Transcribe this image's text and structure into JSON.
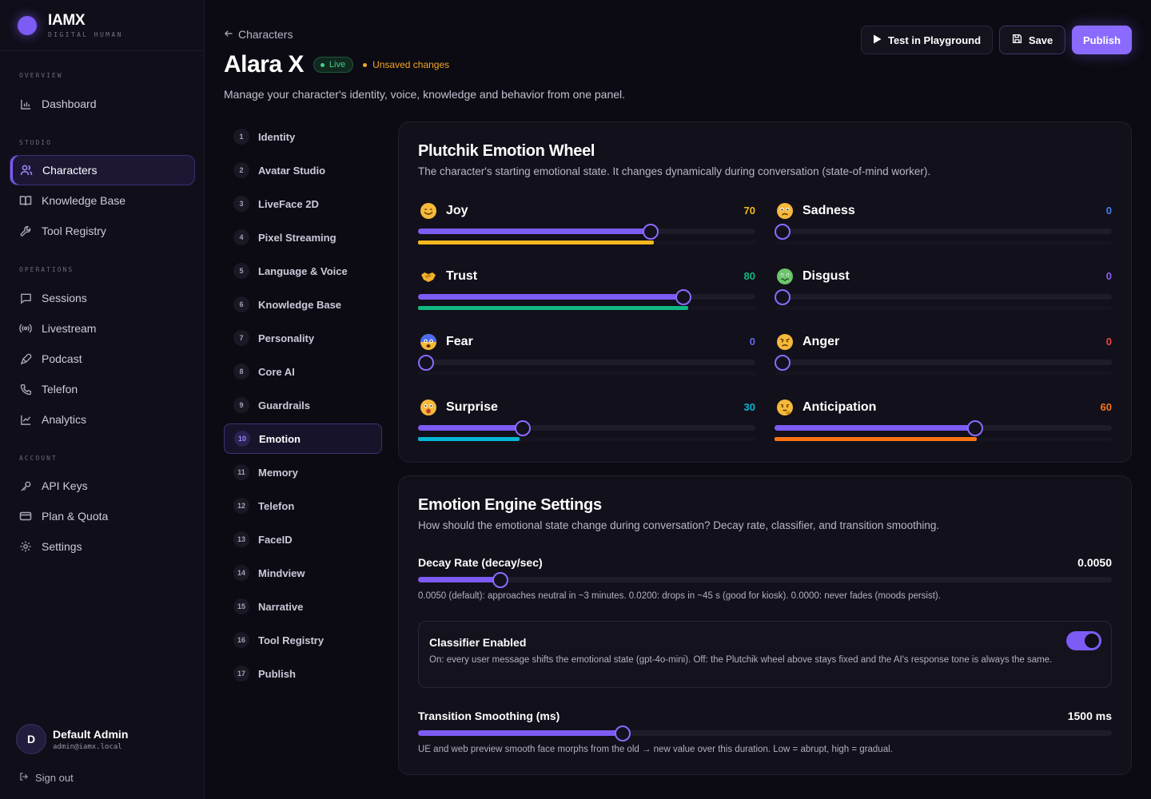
{
  "brand": {
    "name": "IAMX",
    "tagline": "DIGITAL HUMAN"
  },
  "sidebar": {
    "sections": [
      {
        "title": "OVERVIEW",
        "items": [
          {
            "label": "Dashboard",
            "icon": "bar-chart-icon"
          }
        ]
      },
      {
        "title": "STUDIO",
        "items": [
          {
            "label": "Characters",
            "icon": "users-icon",
            "active": true
          },
          {
            "label": "Knowledge Base",
            "icon": "book-icon"
          },
          {
            "label": "Tool Registry",
            "icon": "wrench-icon"
          }
        ]
      },
      {
        "title": "OPERATIONS",
        "items": [
          {
            "label": "Sessions",
            "icon": "chat-icon"
          },
          {
            "label": "Livestream",
            "icon": "broadcast-icon"
          },
          {
            "label": "Podcast",
            "icon": "mic-icon"
          },
          {
            "label": "Telefon",
            "icon": "phone-icon"
          },
          {
            "label": "Analytics",
            "icon": "line-chart-icon"
          }
        ]
      },
      {
        "title": "ACCOUNT",
        "items": [
          {
            "label": "API Keys",
            "icon": "key-icon"
          },
          {
            "label": "Plan & Quota",
            "icon": "card-icon"
          },
          {
            "label": "Settings",
            "icon": "gear-icon"
          }
        ]
      }
    ],
    "user": {
      "initial": "D",
      "name": "Default Admin",
      "email": "admin@iamx.local"
    },
    "sign_out": "Sign out"
  },
  "header": {
    "breadcrumb": "Characters",
    "title": "Alara X",
    "status_badge": "Live",
    "unsaved": "Unsaved changes",
    "subtitle": "Manage your character's identity, voice, knowledge and behavior from one panel.",
    "buttons": {
      "test": "Test in Playground",
      "save": "Save",
      "publish": "Publish"
    }
  },
  "steps": [
    {
      "num": "1",
      "label": "Identity"
    },
    {
      "num": "2",
      "label": "Avatar Studio"
    },
    {
      "num": "3",
      "label": "LiveFace 2D"
    },
    {
      "num": "4",
      "label": "Pixel Streaming"
    },
    {
      "num": "5",
      "label": "Language & Voice"
    },
    {
      "num": "6",
      "label": "Knowledge Base"
    },
    {
      "num": "7",
      "label": "Personality"
    },
    {
      "num": "8",
      "label": "Core AI"
    },
    {
      "num": "9",
      "label": "Guardrails"
    },
    {
      "num": "10",
      "label": "Emotion",
      "active": true
    },
    {
      "num": "11",
      "label": "Memory"
    },
    {
      "num": "12",
      "label": "Telefon"
    },
    {
      "num": "13",
      "label": "FaceID"
    },
    {
      "num": "14",
      "label": "Mindview"
    },
    {
      "num": "15",
      "label": "Narrative"
    },
    {
      "num": "16",
      "label": "Tool Registry"
    },
    {
      "num": "17",
      "label": "Publish"
    }
  ],
  "wheel": {
    "title": "Plutchik Emotion Wheel",
    "description": "The character's starting emotional state. It changes dynamically during conversation (state-of-mind worker).",
    "emotions": [
      {
        "name": "Joy",
        "value": 70,
        "display": "70",
        "color": "#f4b81e",
        "face": "smile"
      },
      {
        "name": "Sadness",
        "value": 0,
        "display": "0",
        "color": "#3b82f6",
        "face": "sad"
      },
      {
        "name": "Trust",
        "value": 80,
        "display": "80",
        "color": "#10b981",
        "face": "handshake"
      },
      {
        "name": "Disgust",
        "value": 0,
        "display": "0",
        "color": "#8b5cf6",
        "face": "disgust"
      },
      {
        "name": "Fear",
        "value": 0,
        "display": "0",
        "color": "#6366f1",
        "face": "fear"
      },
      {
        "name": "Anger",
        "value": 0,
        "display": "0",
        "color": "#ef4444",
        "face": "anger"
      },
      {
        "name": "Surprise",
        "value": 30,
        "display": "30",
        "color": "#06b6d4",
        "face": "surprise"
      },
      {
        "name": "Anticipation",
        "value": 60,
        "display": "60",
        "color": "#f97316",
        "face": "think"
      }
    ]
  },
  "engine": {
    "title": "Emotion Engine Settings",
    "description": "How should the emotional state change during conversation? Decay rate, classifier, and transition smoothing.",
    "decay": {
      "label": "Decay Rate (decay/sec)",
      "value": "0.0050",
      "level": 0.11,
      "note": "0.0050 (default): approaches neutral in ~3 minutes. 0.0200: drops in ~45 s (good for kiosk). 0.0000: never fades (moods persist)."
    },
    "classifier": {
      "title": "Classifier Enabled",
      "enabled": true,
      "description": "On: every user message shifts the emotional state (gpt-4o-mini). Off: the Plutchik wheel above stays fixed and the AI's response tone is always the same."
    },
    "smoothing": {
      "label": "Transition Smoothing (ms)",
      "value": "1500 ms",
      "level": 0.29,
      "note": "UE and web preview smooth face morphs from the old → new value over this duration. Low = abrupt, high = gradual."
    }
  }
}
